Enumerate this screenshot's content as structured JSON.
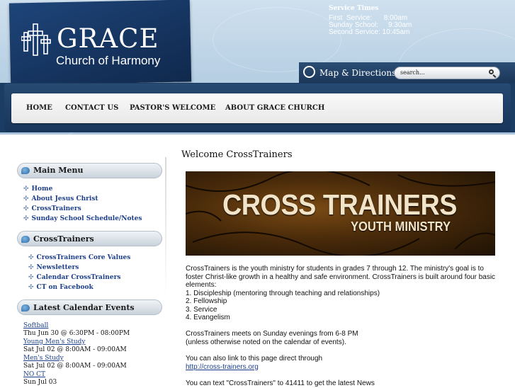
{
  "header": {
    "logo_title": "GRACE",
    "logo_subtitle": "Church of Harmony",
    "service_times": {
      "title": "Service Times",
      "rows": [
        "First  Service:      8:00am",
        "Sunday School:     9:30am",
        "Second Service: 10:45am"
      ]
    },
    "map_label": "Map & Directions",
    "search_value": "search..."
  },
  "nav": {
    "items": [
      "HOME",
      "CONTACT US",
      "PASTOR'S WELCOME",
      "ABOUT GRACE CHURCH"
    ]
  },
  "sidebar": {
    "main_menu": {
      "title": "Main Menu",
      "items": [
        "Home",
        "About Jesus Christ",
        "CrossTrainers",
        "Sunday School Schedule/Notes"
      ]
    },
    "crosstrainers": {
      "title": "CrossTrainers",
      "items": [
        "CrossTrainers Core Values",
        "Newsletters",
        "Calendar CrossTrainers",
        "CT on Facebook"
      ]
    },
    "events": {
      "title": "Latest Calendar Events",
      "items": [
        {
          "name": "Softball",
          "time": "Thu Jun 30 @ 6:30PM - 08:00PM"
        },
        {
          "name": "Young Men's Study",
          "time": "Sat Jul 02 @ 8:00AM - 09:00AM"
        },
        {
          "name": "Men's Study",
          "time": "Sat Jul 02 @ 8:00AM - 09:00AM"
        },
        {
          "name": "NO CT",
          "time": "Sun Jul 03"
        }
      ]
    }
  },
  "content": {
    "title": "Welcome CrossTrainers",
    "banner_line1": "CROSS TRAINERS",
    "banner_line2": "YOUTH MINISTRY",
    "paragraph1": [
      "CrossTrainers is the youth ministry for students in grades 7 through 12. The ministry's goal is to",
      "foster Christ-like growth in a healthy and safe environment. CrossTrainers is built around four basic",
      "elements:",
      "1. Discipleship (mentoring through teaching and relationships)",
      "2. Fellowship",
      "3. Service",
      "4. Evangelism"
    ],
    "paragraph2": [
      "CrossTrainers meets on Sunday evenings from 6-8 PM",
      "(unless otherwise noted on the calendar of events)."
    ],
    "link_intro": "You can also link to this page direct through",
    "link_url": "http://cross-trainers.org",
    "text_note": "You can text \"CrossTrainers\" to 41411 to get the latest News"
  },
  "colors": {
    "brand_navy": "#15335e",
    "header_sky": "#bcd3e6",
    "link_blue": "#1d3f8a"
  }
}
